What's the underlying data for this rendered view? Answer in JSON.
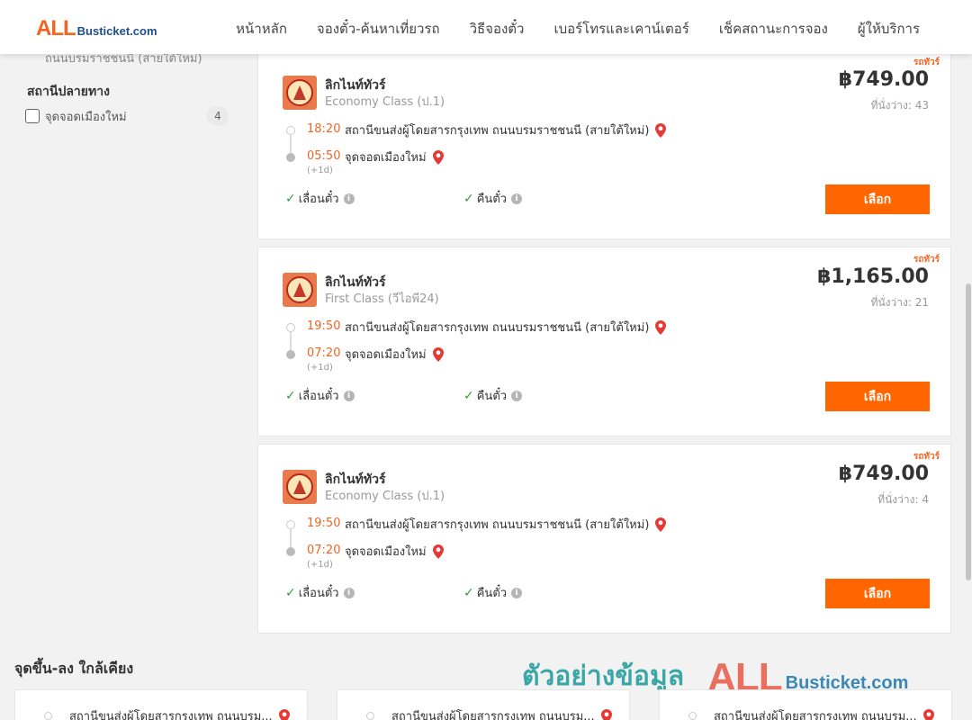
{
  "header": {
    "logo_all": "ALL",
    "logo_rest": "Busticket.com",
    "nav": [
      "หน้าหลัก",
      "จองตั๋ว-ค้นหาเที่ยวรถ",
      "วิธีจองตั๋ว",
      "เบอร์โทรและเคาน์เตอร์",
      "เช็คสถานะการจอง",
      "ผู้ให้บริการ"
    ]
  },
  "sidebar": {
    "cut_text": "ถนนบรมราชชนนี (สายใต้ใหม่)",
    "destination_title": "สถานีปลายทาง",
    "destination_items": [
      {
        "label": "จุดจอดเมืองใหม่",
        "count": "4"
      }
    ]
  },
  "trips": [
    {
      "type": "รถทัวร์",
      "operator": "ลิกไนท์ทัวร์",
      "class": "Economy Class (ป.1)",
      "price": "฿749.00",
      "seats": "ที่นั่งว่าง: 43",
      "depart_time": "18:20",
      "depart_place": "สถานีขนส่งผู้โดยสารกรุงเทพ ถนนบรมราชชนนี (สายใต้ใหม่)",
      "arrive_time": "05:50",
      "arrive_place": "จุดจอดเมืองใหม่",
      "next_day": "(+1d)",
      "feature1": "เลื่อนตั๋ว",
      "feature2": "คืนตั๋ว",
      "button": "เลือก"
    },
    {
      "type": "รถทัวร์",
      "operator": "ลิกไนท์ทัวร์",
      "class": "First Class (วีไอพี24)",
      "price": "฿1,165.00",
      "seats": "ที่นั่งว่าง: 21",
      "depart_time": "19:50",
      "depart_place": "สถานีขนส่งผู้โดยสารกรุงเทพ ถนนบรมราชชนนี (สายใต้ใหม่)",
      "arrive_time": "07:20",
      "arrive_place": "จุดจอดเมืองใหม่",
      "next_day": "(+1d)",
      "feature1": "เลื่อนตั๋ว",
      "feature2": "คืนตั๋ว",
      "button": "เลือก"
    },
    {
      "type": "รถทัวร์",
      "operator": "ลิกไนท์ทัวร์",
      "class": "Economy Class (ป.1)",
      "price": "฿749.00",
      "seats": "ที่นั่งว่าง: 4",
      "depart_time": "19:50",
      "depart_place": "สถานีขนส่งผู้โดยสารกรุงเทพ ถนนบรมราชชนนี (สายใต้ใหม่)",
      "arrive_time": "07:20",
      "arrive_place": "จุดจอดเมืองใหม่",
      "next_day": "(+1d)",
      "feature1": "เลื่อนตั๋ว",
      "feature2": "คืนตั๋ว",
      "button": "เลือก"
    }
  ],
  "nearby": {
    "title": "จุดขึ้น-ลง ใกล้เคียง",
    "items": [
      "สถานีขนส่งผู้โดยสารกรุงเทพ ถนนบรม...",
      "สถานีขนส่งผู้โดยสารกรุงเทพ ถนนบรม...",
      "สถานีขนส่งผู้โดยสารกรุงเทพ ถนนบรม..."
    ]
  },
  "watermark": {
    "text": "ตัวอย่างข้อมูล",
    "all": "ALL",
    "rest": "Busticket.com"
  },
  "colors": {
    "accent": "#ff6600",
    "time": "#f26522",
    "check": "#2e9e3b",
    "pin": "#e53935"
  },
  "icons": [
    "map-pin-icon",
    "check-icon",
    "info-icon",
    "checkbox-icon"
  ]
}
